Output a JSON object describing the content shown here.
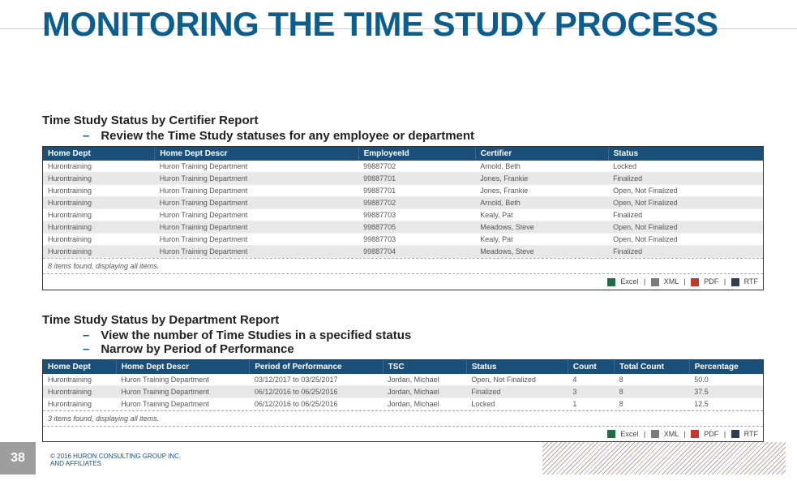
{
  "page": {
    "title": "MONITORING THE TIME STUDY PROCESS",
    "number": "38",
    "copyright_line1": "© 2016 HURON CONSULTING GROUP INC.",
    "copyright_line2": "AND AFFILIATES"
  },
  "section1": {
    "header": "Time Study Status by Certifier Report",
    "bullet1": "Review the Time Study statuses for any employee or department",
    "table": {
      "headers": [
        "Home Dept",
        "Home Dept Descr",
        "EmployeeId",
        "Certifier",
        "Status"
      ],
      "rows": [
        [
          "Hurontraining",
          "Huron Training Department",
          "99887702",
          "Arnold, Beth",
          "Locked"
        ],
        [
          "Hurontraining",
          "Huron Training Department",
          "99887701",
          "Jones, Frankie",
          "Finalized"
        ],
        [
          "Hurontraining",
          "Huron Training Department",
          "99887701",
          "Jones, Frankie",
          "Open, Not Finalized"
        ],
        [
          "Hurontraining",
          "Huron Training Department",
          "99887702",
          "Arnold, Beth",
          "Open, Not Finalized"
        ],
        [
          "Hurontraining",
          "Huron Training Department",
          "99887703",
          "Kealy, Pat",
          "Finalized"
        ],
        [
          "Hurontraining",
          "Huron Training Department",
          "99887705",
          "Meadows, Steve",
          "Open, Not Finalized"
        ],
        [
          "Hurontraining",
          "Huron Training Department",
          "99887703",
          "Kealy, Pat",
          "Open, Not Finalized"
        ],
        [
          "Hurontraining",
          "Huron Training Department",
          "99887704",
          "Meadows, Steve",
          "Finalized"
        ]
      ],
      "footer": "8 items found, displaying all items."
    }
  },
  "section2": {
    "header": "Time Study Status by Department Report",
    "bullet1": "View the number of Time Studies in a specified status",
    "bullet2": "Narrow by Period of Performance",
    "table": {
      "headers": [
        "Home Dept",
        "Home Dept Descr",
        "Period of Performance",
        "TSC",
        "Status",
        "Count",
        "Total Count",
        "Percentage"
      ],
      "rows": [
        [
          "Hurontraining",
          "Huron Training Department",
          "03/12/2017 to 03/25/2017",
          "Jordan, Michael",
          "Open, Not Finalized",
          "4",
          "8",
          "50.0"
        ],
        [
          "Hurontraining",
          "Huron Training Department",
          "06/12/2016 to 06/25/2016",
          "Jordan, Michael",
          "Finalized",
          "3",
          "8",
          "37.5"
        ],
        [
          "Hurontraining",
          "Huron Training Department",
          "06/12/2016 to 06/25/2016",
          "Jordan, Michael",
          "Locked",
          "1",
          "8",
          "12.5"
        ]
      ],
      "footer": "3 items found, displaying all items."
    }
  },
  "export": {
    "excel": "Excel",
    "xml": "XML",
    "pdf": "PDF",
    "rtf": "RTF",
    "sep": " | "
  }
}
